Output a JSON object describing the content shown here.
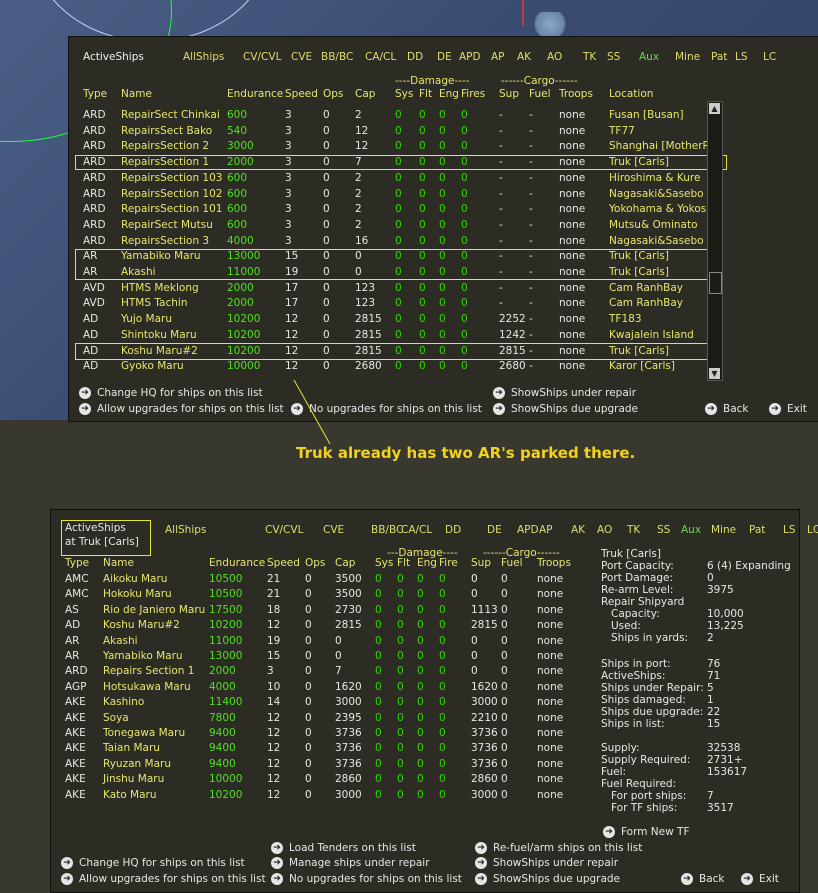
{
  "tabs": [
    {
      "label": "ActiveShips",
      "style": "active"
    },
    {
      "label": "AllShips",
      "style": ""
    },
    {
      "label": "CV/CVL",
      "style": ""
    },
    {
      "label": "CVE",
      "style": ""
    },
    {
      "label": "BB/BC",
      "style": ""
    },
    {
      "label": "CA/CL",
      "style": ""
    },
    {
      "label": "DD",
      "style": ""
    },
    {
      "label": "DE",
      "style": ""
    },
    {
      "label": "APD",
      "style": ""
    },
    {
      "label": "AP",
      "style": ""
    },
    {
      "label": "AK",
      "style": ""
    },
    {
      "label": "AO",
      "style": ""
    },
    {
      "label": "TK",
      "style": ""
    },
    {
      "label": "SS",
      "style": ""
    },
    {
      "label": "Aux",
      "style": "aux"
    },
    {
      "label": "Mine",
      "style": ""
    },
    {
      "label": "Pat",
      "style": ""
    },
    {
      "label": "LS",
      "style": ""
    },
    {
      "label": "LC",
      "style": ""
    }
  ],
  "panel1": {
    "group_damage": "----Damage----",
    "group_cargo": "------Cargo------",
    "columns": [
      "Type",
      "Name",
      "Endurance",
      "Speed",
      "Ops",
      "Cap",
      "Sys",
      "Flt",
      "Eng",
      "Fires",
      "Sup",
      "Fuel",
      "Troops",
      "Location"
    ],
    "rows": [
      [
        "ARD",
        "RepairSect Chinkai",
        "600",
        "3",
        "0",
        "2",
        "0",
        "0",
        "0",
        "0",
        "-",
        "-",
        "none",
        "Fusan [Busan]"
      ],
      [
        "ARD",
        "RepairsSect Bako",
        "540",
        "3",
        "0",
        "12",
        "0",
        "0",
        "0",
        "0",
        "-",
        "-",
        "none",
        "TF77"
      ],
      [
        "ARD",
        "RepairsSection 2",
        "3000",
        "3",
        "0",
        "12",
        "0",
        "0",
        "0",
        "0",
        "-",
        "-",
        "none",
        "Shanghai [MotherRo"
      ],
      [
        "ARD",
        "RepairsSection 1",
        "2000",
        "3",
        "0",
        "7",
        "0",
        "0",
        "0",
        "0",
        "-",
        "-",
        "none",
        "Truk [Carls]"
      ],
      [
        "ARD",
        "RepairsSection 103",
        "600",
        "3",
        "0",
        "2",
        "0",
        "0",
        "0",
        "0",
        "-",
        "-",
        "none",
        "Hiroshima & Kure"
      ],
      [
        "ARD",
        "RepairsSection 102",
        "600",
        "3",
        "0",
        "2",
        "0",
        "0",
        "0",
        "0",
        "-",
        "-",
        "none",
        "Nagasaki&Sasebo"
      ],
      [
        "ARD",
        "RepairsSection 101",
        "600",
        "3",
        "0",
        "2",
        "0",
        "0",
        "0",
        "0",
        "-",
        "-",
        "none",
        "Yokohama & Yokos"
      ],
      [
        "ARD",
        "RepairSect Mutsu",
        "600",
        "3",
        "0",
        "2",
        "0",
        "0",
        "0",
        "0",
        "-",
        "-",
        "none",
        "Mutsu& Ominato"
      ],
      [
        "ARD",
        "RepairsSection 3",
        "4000",
        "3",
        "0",
        "16",
        "0",
        "0",
        "0",
        "0",
        "-",
        "-",
        "none",
        "Nagasaki&Sasebo"
      ],
      [
        "AR",
        "Yamabiko Maru",
        "13000",
        "15",
        "0",
        "0",
        "0",
        "0",
        "0",
        "0",
        "-",
        "-",
        "none",
        "Truk [Carls]"
      ],
      [
        "AR",
        "Akashi",
        "11000",
        "19",
        "0",
        "0",
        "0",
        "0",
        "0",
        "0",
        "-",
        "-",
        "none",
        "Truk [Carls]"
      ],
      [
        "AVD",
        "HTMS Meklong",
        "2000",
        "17",
        "0",
        "123",
        "0",
        "0",
        "0",
        "0",
        "-",
        "-",
        "none",
        "Cam RanhBay"
      ],
      [
        "AVD",
        "HTMS Tachin",
        "2000",
        "17",
        "0",
        "123",
        "0",
        "0",
        "0",
        "0",
        "-",
        "-",
        "none",
        "Cam RanhBay"
      ],
      [
        "AD",
        "Yujo Maru",
        "10200",
        "12",
        "0",
        "2815",
        "0",
        "0",
        "0",
        "0",
        "2252",
        "-",
        "none",
        "TF183"
      ],
      [
        "AD",
        "Shintoku Maru",
        "10200",
        "12",
        "0",
        "2815",
        "0",
        "0",
        "0",
        "0",
        "1242",
        "-",
        "none",
        "Kwajalein Island"
      ],
      [
        "AD",
        "Koshu Maru#2",
        "10200",
        "12",
        "0",
        "2815",
        "0",
        "0",
        "0",
        "0",
        "2815",
        "-",
        "none",
        "Truk [Carls]"
      ],
      [
        "AD",
        "Gyoko Maru",
        "10000",
        "12",
        "0",
        "2680",
        "0",
        "0",
        "0",
        "0",
        "2680",
        "-",
        "none",
        "Karor [Carls]"
      ]
    ],
    "commands_left": [
      "Change HQ for ships on this list",
      "Allow upgrades for ships on this list"
    ],
    "commands_mid": [
      "No upgrades for ships on this list"
    ],
    "commands_right": [
      "ShowShips under repair",
      "ShowShips due upgrade"
    ],
    "back": "Back",
    "exit": "Exit"
  },
  "annotation": "Truk already has two AR's parked there.",
  "panel2": {
    "title_line1": "ActiveShips",
    "title_line2": "at Truk [Carls]",
    "group_damage": "---Damage----",
    "group_cargo": "------Cargo------",
    "columns": [
      "Type",
      "Name",
      "Endurance",
      "Speed",
      "Ops",
      "Cap",
      "Sys",
      "Flt",
      "Eng",
      "Fire",
      "Sup",
      "Fuel",
      "Troops"
    ],
    "rows": [
      [
        "AMC",
        "Aikoku Maru",
        "10500",
        "21",
        "0",
        "3500",
        "0",
        "0",
        "0",
        "0",
        "0",
        "0",
        "none"
      ],
      [
        "AMC",
        "Hokoku Maru",
        "10500",
        "21",
        "0",
        "3500",
        "0",
        "0",
        "0",
        "0",
        "0",
        "0",
        "none"
      ],
      [
        "AS",
        "Rio de Janiero Maru",
        "17500",
        "18",
        "0",
        "2730",
        "0",
        "0",
        "0",
        "0",
        "1113",
        "0",
        "none"
      ],
      [
        "AD",
        "Koshu Maru#2",
        "10200",
        "12",
        "0",
        "2815",
        "0",
        "0",
        "0",
        "0",
        "2815",
        "0",
        "none"
      ],
      [
        "AR",
        "Akashi",
        "11000",
        "19",
        "0",
        "0",
        "0",
        "0",
        "0",
        "0",
        "0",
        "0",
        "none"
      ],
      [
        "AR",
        "Yamabiko Maru",
        "13000",
        "15",
        "0",
        "0",
        "0",
        "0",
        "0",
        "0",
        "0",
        "0",
        "none"
      ],
      [
        "ARD",
        "Repairs Section 1",
        "2000",
        "3",
        "0",
        "7",
        "0",
        "0",
        "0",
        "0",
        "0",
        "0",
        "none"
      ],
      [
        "AGP",
        "Hotsukawa Maru",
        "4000",
        "10",
        "0",
        "1620",
        "0",
        "0",
        "0",
        "0",
        "1620",
        "0",
        "none"
      ],
      [
        "AKE",
        "Kashino",
        "11400",
        "14",
        "0",
        "3000",
        "0",
        "0",
        "0",
        "0",
        "3000",
        "0",
        "none"
      ],
      [
        "AKE",
        "Soya",
        "7800",
        "12",
        "0",
        "2395",
        "0",
        "0",
        "0",
        "0",
        "2210",
        "0",
        "none"
      ],
      [
        "AKE",
        "Tonegawa Maru",
        "9400",
        "12",
        "0",
        "3736",
        "0",
        "0",
        "0",
        "0",
        "3736",
        "0",
        "none"
      ],
      [
        "AKE",
        "Taian Maru",
        "9400",
        "12",
        "0",
        "3736",
        "0",
        "0",
        "0",
        "0",
        "3736",
        "0",
        "none"
      ],
      [
        "AKE",
        "Ryuzan Maru",
        "9400",
        "12",
        "0",
        "3736",
        "0",
        "0",
        "0",
        "0",
        "3736",
        "0",
        "none"
      ],
      [
        "AKE",
        "Jinshu Maru",
        "10000",
        "12",
        "0",
        "2860",
        "0",
        "0",
        "0",
        "0",
        "2860",
        "0",
        "none"
      ],
      [
        "AKE",
        "Kato Maru",
        "10200",
        "12",
        "0",
        "3000",
        "0",
        "0",
        "0",
        "0",
        "3000",
        "0",
        "none"
      ]
    ],
    "info": {
      "base_name": "Truk [Carls]",
      "port_capacity_label": "Port Capacity:",
      "port_capacity": "6 (4) Expanding",
      "port_damage_label": "Port Damage:",
      "port_damage": "0",
      "rearm_label": "Re-arm Level:",
      "rearm": "3975",
      "shipyard_label": "Repair Shipyard",
      "capacity_label": "Capacity:",
      "capacity": "10,000",
      "used_label": "Used:",
      "used": "13,225",
      "inyards_label": "Ships in yards:",
      "inyards": "2",
      "inport_label": "Ships in port:",
      "inport": "76",
      "active_label": "ActiveShips:",
      "active": "71",
      "underrepair_label": "Ships under Repair:",
      "underrepair": "5",
      "damaged_label": "Ships damaged:",
      "damaged": "1",
      "dueupgrade_label": "Ships due upgrade:",
      "dueupgrade": "22",
      "inlist_label": "Ships in list:",
      "inlist": "15",
      "supply_label": "Supply:",
      "supply": "32538",
      "supplyreq_label": "Supply Required:",
      "supplyreq": "2731+",
      "fuel_label": "Fuel:",
      "fuel": "153617",
      "fuelreq_label": "Fuel Required:",
      "portships_label": "For port ships:",
      "portships": "7",
      "tfships_label": "For TF ships:",
      "tfships": "3517"
    },
    "form_new_tf": "Form New TF",
    "cmd_load": "Load Tenders on this list",
    "cmd_manage": "Manage ships under repair",
    "cmd_noupg": "No upgrades for ships on this list",
    "cmd_changehq": "Change HQ for ships on this list",
    "cmd_allowupg": "Allow upgrades for ships on this list",
    "cmd_refuel": "Re-fuel/arm ships on this list",
    "cmd_underrepair": "ShowShips under repair",
    "cmd_dueupgrade": "ShowShips due upgrade",
    "back": "Back",
    "exit": "Exit"
  }
}
